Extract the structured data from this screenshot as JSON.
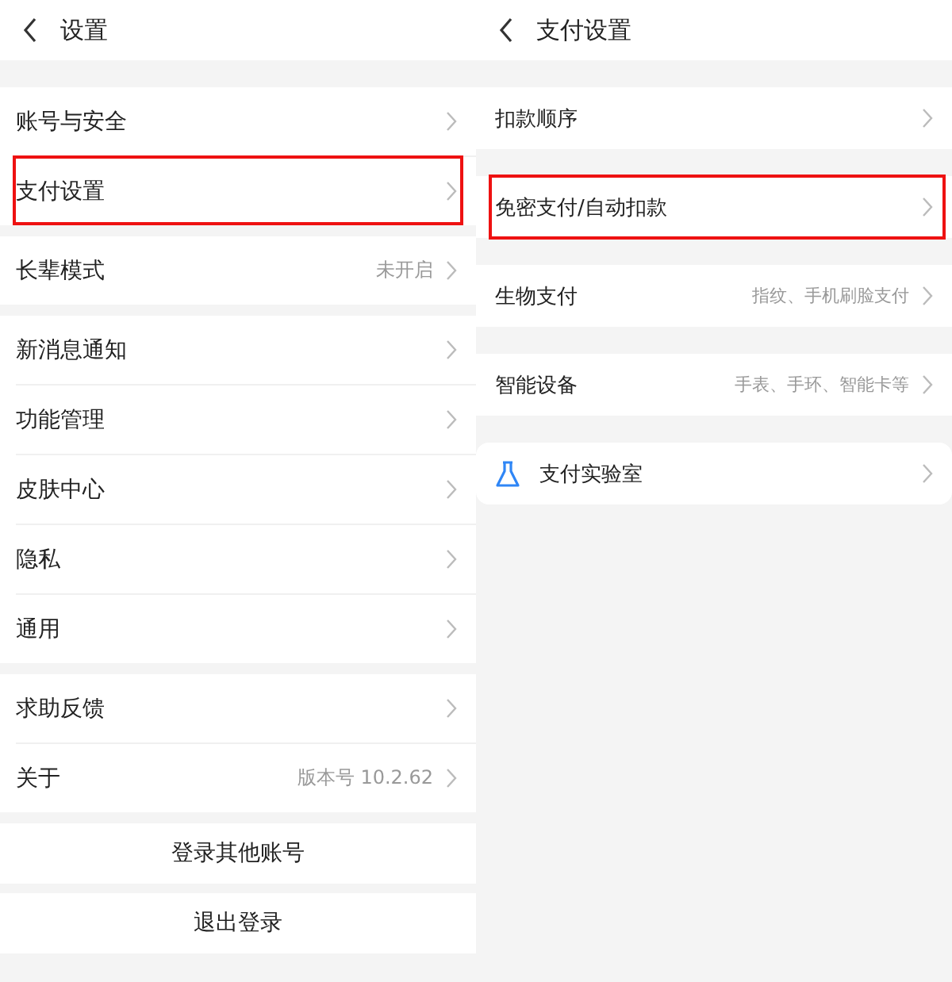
{
  "panels": [
    {
      "title": "设置",
      "groups": [
        {
          "rows": [
            {
              "kind": "link",
              "label": "账号与安全",
              "highlighted": false
            },
            {
              "kind": "link",
              "label": "支付设置",
              "highlighted": true
            }
          ]
        },
        {
          "rows": [
            {
              "kind": "link",
              "label": "长辈模式",
              "value": "未开启",
              "highlighted": false
            }
          ]
        },
        {
          "rows": [
            {
              "kind": "link",
              "label": "新消息通知",
              "highlighted": false
            },
            {
              "kind": "link",
              "label": "功能管理",
              "highlighted": false
            },
            {
              "kind": "link",
              "label": "皮肤中心",
              "highlighted": false
            },
            {
              "kind": "link",
              "label": "隐私",
              "highlighted": false
            },
            {
              "kind": "link",
              "label": "通用",
              "highlighted": false
            }
          ]
        },
        {
          "rows": [
            {
              "kind": "link",
              "label": "求助反馈",
              "highlighted": false
            },
            {
              "kind": "link",
              "label": "关于",
              "value": "版本号 10.2.62",
              "highlighted": false
            }
          ]
        }
      ],
      "actions": [
        "登录其他账号",
        "退出登录"
      ]
    },
    {
      "title": "支付设置",
      "groups": [
        {
          "rows": [
            {
              "kind": "link",
              "label": "扣款顺序",
              "highlighted": false
            }
          ]
        },
        {
          "rows": [
            {
              "kind": "link",
              "label": "免密支付/自动扣款",
              "highlighted": true
            }
          ]
        },
        {
          "rows": [
            {
              "kind": "link",
              "label": "生物支付",
              "value": "指纹、手机刷脸支付",
              "highlighted": false
            }
          ]
        },
        {
          "rows": [
            {
              "kind": "link",
              "label": "智能设备",
              "value": "手表、手环、智能卡等",
              "highlighted": false
            }
          ]
        },
        {
          "rows": [
            {
              "kind": "lab",
              "label": "支付实验室",
              "highlighted": false
            }
          ]
        }
      ]
    }
  ]
}
